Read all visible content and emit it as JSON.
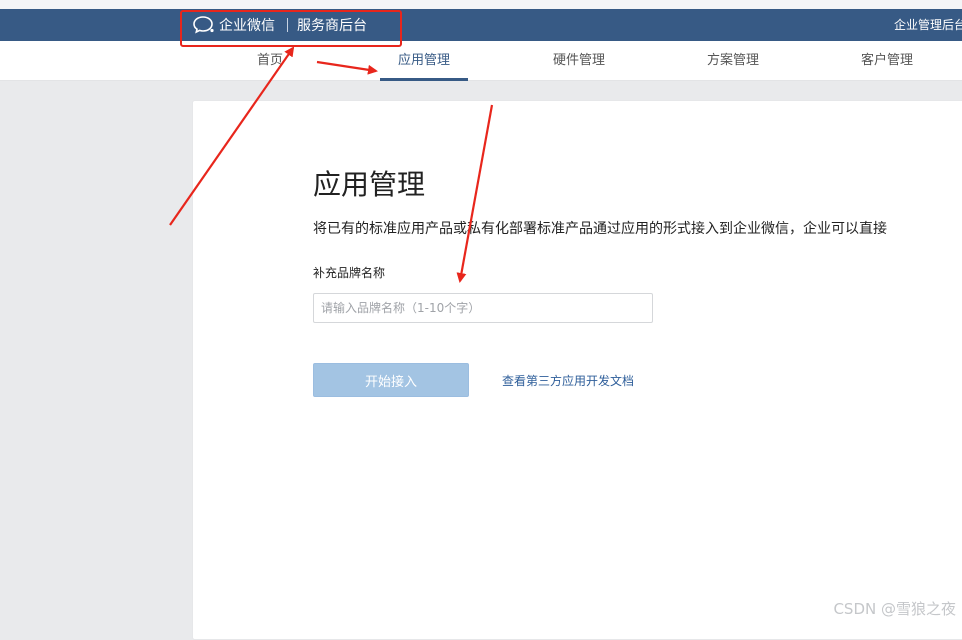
{
  "header": {
    "brand_name": "企业微信",
    "brand_sub": "服务商后台",
    "right_text": "企业管理后台",
    "icon": "chat-bubble-icon"
  },
  "nav": {
    "items": [
      {
        "label": "首页"
      },
      {
        "label": "应用管理",
        "active": true
      },
      {
        "label": "硬件管理"
      },
      {
        "label": "方案管理"
      },
      {
        "label": "客户管理"
      }
    ]
  },
  "main": {
    "title": "应用管理",
    "description": "将已有的标准应用产品或私有化部署标准产品通过应用的形式接入到企业微信，企业可以直接",
    "field_label": "补充品牌名称",
    "input_placeholder": "请输入品牌名称（1-10个字）",
    "input_value": "",
    "start_button_label": "开始接入",
    "docs_link_label": "查看第三方应用开发文档"
  },
  "annotations": {
    "highlight_color": "#e8261c"
  },
  "watermark": "CSDN @雪狼之夜",
  "colors": {
    "header_bg": "#375a85",
    "accent": "#375a85",
    "button_bg": "#a3c4e3",
    "link": "#2e5e9a",
    "annotation_red": "#e8261c"
  }
}
